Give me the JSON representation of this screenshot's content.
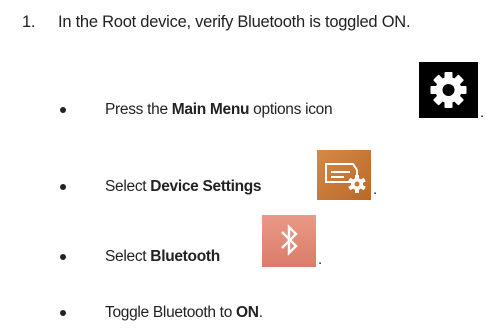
{
  "step": {
    "number": "1.",
    "text": "In the Root device, verify Bluetooth is toggled ON."
  },
  "bullets": [
    {
      "prefix": "Press the ",
      "bold": "Main Menu",
      "suffix": " options icon",
      "end": ".",
      "icon": "gear-icon"
    },
    {
      "prefix": "Select ",
      "bold": "Device Settings",
      "suffix": " ",
      "end": ".",
      "icon": "device-settings-icon"
    },
    {
      "prefix": "Select ",
      "bold": "Bluetooth",
      "suffix": " ",
      "end": ".",
      "icon": "bluetooth-icon"
    },
    {
      "prefix": "Toggle Bluetooth to ",
      "bold": "ON",
      "suffix": "",
      "end": "."
    }
  ],
  "colors": {
    "gear_tile": "#000000",
    "device_settings_tile": "#c87533",
    "bluetooth_tile": "#e58a78"
  }
}
